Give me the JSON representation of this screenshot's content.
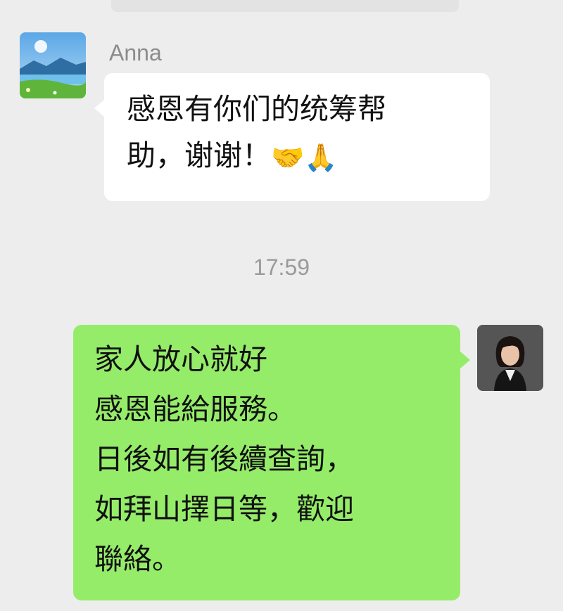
{
  "chat": {
    "previous_message_fragment": "",
    "incoming": {
      "sender": "Anna",
      "line1": "感恩有你们的统筹帮",
      "line2": "助，谢谢！",
      "emoji1": "🤝",
      "emoji2": "🙏"
    },
    "timestamp": "17:59",
    "outgoing": {
      "lines": [
        "家人放心就好",
        "感恩能給服務。",
        "日後如有後續查詢，",
        "如拜山擇日等，歡迎",
        "聯絡。"
      ]
    }
  },
  "colors": {
    "background": "#ededed",
    "incoming_bubble": "#ffffff",
    "outgoing_bubble": "#95ec69"
  }
}
